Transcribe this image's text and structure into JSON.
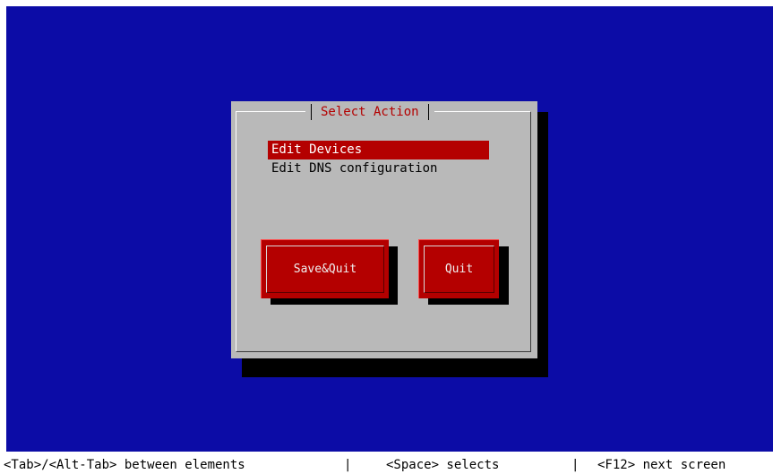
{
  "dialog": {
    "title": "Select Action",
    "items": [
      {
        "label": "Edit Devices",
        "selected": true
      },
      {
        "label": "Edit DNS configuration",
        "selected": false
      }
    ],
    "buttons": {
      "save_quit": "Save&Quit",
      "quit": "Quit"
    }
  },
  "status_bar": {
    "tab_hint": "<Tab>/<Alt-Tab> between elements",
    "sep1": "|",
    "space_hint": "<Space> selects",
    "sep2": "|",
    "f12_hint": "<F12> next screen"
  },
  "colors": {
    "background": "#0c0ca6",
    "dialog": "#b9b9b9",
    "accent": "#b40000",
    "shadow": "#000000"
  }
}
